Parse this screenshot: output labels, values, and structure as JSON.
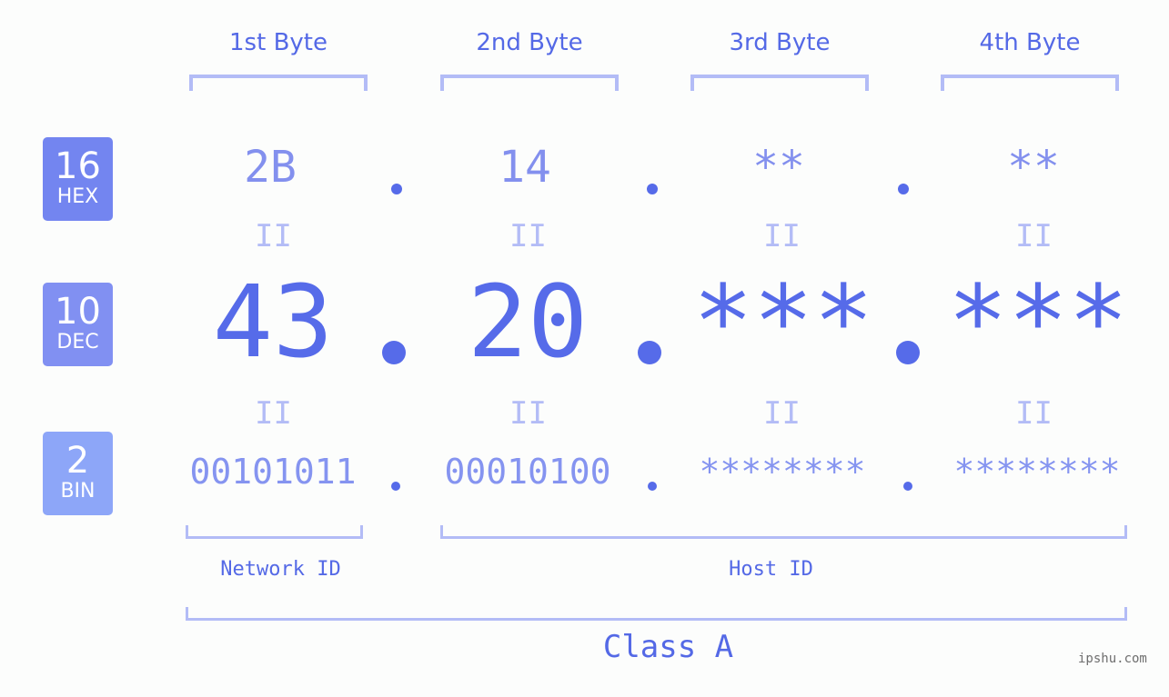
{
  "headers": [
    "1st Byte",
    "2nd Byte",
    "3rd Byte",
    "4th Byte"
  ],
  "badges": [
    {
      "number": "16",
      "label": "HEX",
      "color": "#7385f0"
    },
    {
      "number": "10",
      "label": "DEC",
      "color": "#8190f2"
    },
    {
      "number": "2",
      "label": "BIN",
      "color": "#8da6f8"
    }
  ],
  "hex": [
    "2B",
    "14",
    "**",
    "**"
  ],
  "dec": [
    "43",
    "20",
    "***",
    "***"
  ],
  "bin": [
    "00101011",
    "00010100",
    "********",
    "********"
  ],
  "equals_sign": "II",
  "network_id_label": "Network ID",
  "host_id_label": "Host ID",
  "class_label": "Class A",
  "watermark": "ipshu.com",
  "colors": {
    "accent": "#566be9",
    "bracket": "#b3bcf6",
    "background": "#fcfdfc"
  }
}
